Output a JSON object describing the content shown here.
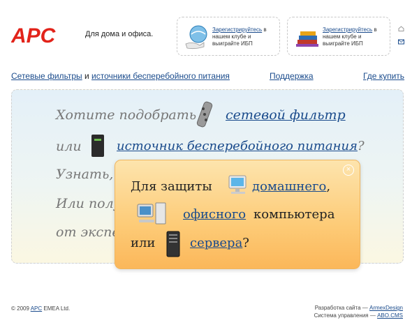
{
  "header": {
    "logo_text": "APC",
    "tagline": "Для дома и офиса."
  },
  "promos": [
    {
      "link": "Зарегистрируйтесь",
      "text_after_link": " в нашем клубе и выиграйте ИБП",
      "icon": "globe-hand-icon"
    },
    {
      "link": "Зарегистрируйтесь",
      "text_after_link": " в нашем клубе и выиграйте ИБП",
      "icon": "book-stack-icon"
    }
  ],
  "side_icons": [
    "home-icon",
    "mail-icon"
  ],
  "nav": {
    "surge_filters": "Сетевые фильтры",
    "and": " и ",
    "ups": "источники бесперебойного питания",
    "support": "Поддержка",
    "where_to_buy": "Где купить"
  },
  "main": {
    "line1_text": "Хотите подобрать",
    "line1_link": "сетевой фильтр",
    "line2_text": "или",
    "line2_link": "источник бесперебойного питания",
    "line2_suffix": "?",
    "line3_text": "Узнать,",
    "line4_text": "Или полу",
    "line5_text": "от экспе"
  },
  "popup": {
    "close": "×",
    "line1_text": "Для защиты",
    "line1_link": "домашнего",
    "line1_suffix": ",",
    "line2_link": "офисного",
    "line2_text": "компьютера",
    "line3_text": "или",
    "line3_link": "сервера",
    "line3_suffix": "?"
  },
  "footer": {
    "copyright_prefix": "© 2009 ",
    "copyright_link": "APC",
    "copyright_suffix": " EMEA Ltd.",
    "dev_label": "Разработка сайта — ",
    "dev_link": "ArmexDesign",
    "cms_label": "Система управления — ",
    "cms_link": "ABO.CMS"
  },
  "colors": {
    "brand_red": "#e2231a",
    "link_blue": "#1a4b8c",
    "popup_orange": "#fcc472"
  }
}
